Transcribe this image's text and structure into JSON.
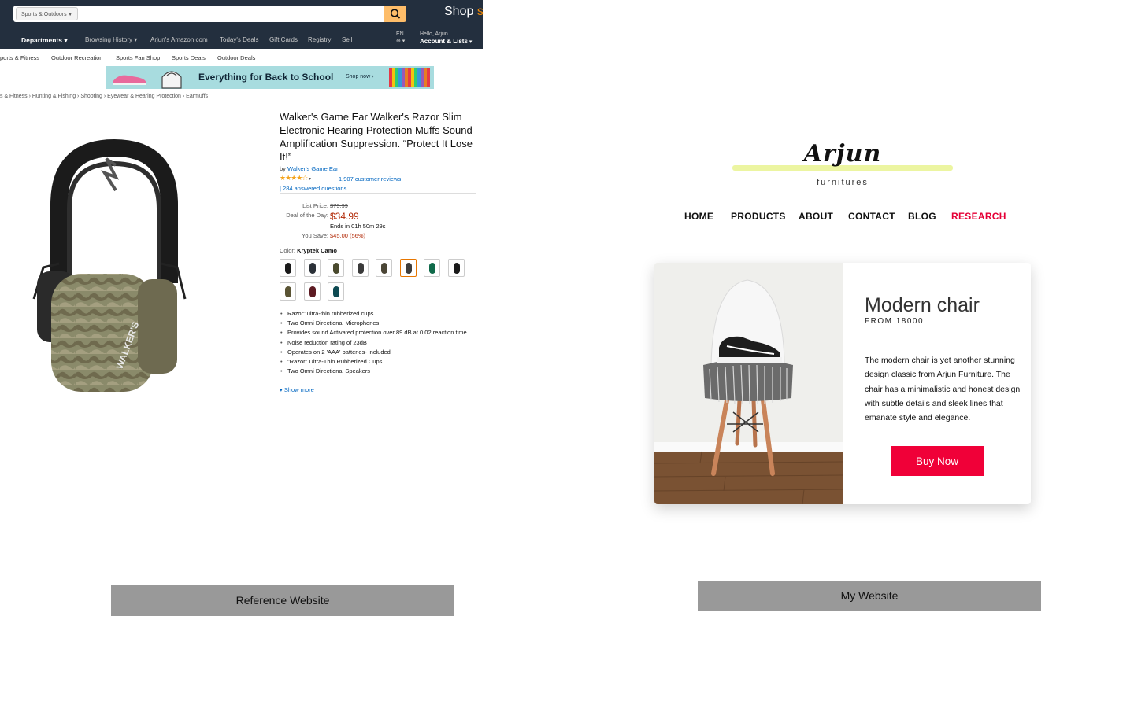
{
  "reference": {
    "search_category": "Sports & Outdoors",
    "shop_text_a": "Shop ",
    "shop_text_b": "s",
    "nav": [
      "Departments",
      "Browsing History",
      "Arjun's Amazon.com",
      "Today's Deals",
      "Gift Cards",
      "Registry",
      "Sell"
    ],
    "lang": "EN",
    "account_hello": "Hello, Arjun",
    "account_label": "Account & Lists",
    "subnav": [
      "ports & Fitness",
      "Outdoor Recreation",
      "Sports Fan Shop",
      "Sports Deals",
      "Outdoor Deals"
    ],
    "banner_text": "Everything for Back to School",
    "banner_cta": "Shop now ›",
    "breadcrumb": "s & Fitness  ›  Hunting & Fishing  ›  Shooting  ›  Eyewear & Hearing Protection  ›  Earmuffs",
    "product_title": "Walker's Game Ear Walker's Razor Slim Electronic Hearing Protection Muffs Sound Amplification Suppression. “Protect It Lose It!”",
    "by_label": "by ",
    "brand_link": "Walker's Game Ear",
    "stars": "★★★★☆",
    "reviews": "1,907 customer reviews",
    "questions": "|  284 answered questions",
    "list_price_label": "List Price:",
    "list_price": "$79.99",
    "deal_label": "Deal of the Day:",
    "deal_price": "$34.99",
    "ends_in": "Ends in 01h 50m 29s",
    "you_save_label": "You Save:",
    "you_save": "$45.00 (56%)",
    "color_label": "Color: ",
    "color_value": "Kryptek Camo",
    "swatch_colors": [
      "#1a1a1a",
      "#2b3138",
      "#4a4a2e",
      "#3a3a3a",
      "#4b4636",
      "#3d3d3d",
      "#0f6a4a",
      "#1a1a1a",
      "#5a5434",
      "#5c1a22",
      "#0e4a52"
    ],
    "selected_swatch": 5,
    "bullets": [
      "Razor\" ultra-thin rubberized cups",
      "Two Omni Directional Microphones",
      "Provides sound Activated protection over 89 dB at 0.02 reaction time",
      "Noise reduction rating of 23dB",
      "Operates on 2 'AAA' batteries- included",
      "\"Razor\" Ultra-Thin Rubberized Cups",
      "Two Omni Directional Speakers"
    ],
    "show_more": "Show more",
    "caption": "Reference Website"
  },
  "mine": {
    "brand": "Arjun",
    "brand_sub": "furnitures",
    "nav": [
      "HOME",
      "PRODUCTS",
      "ABOUT",
      "CONTACT",
      "BLOG",
      "RESEARCH"
    ],
    "active_nav": "RESEARCH",
    "accent": "#f00038",
    "product_title": "Modern chair",
    "price_line": "FROM 18000",
    "description": "The modern chair is yet another stunning design classic from Arjun Furniture. The chair has a minimalistic and honest design with subtle details and sleek lines that emanate style and elegance.",
    "buy_label": "Buy Now",
    "caption": "My Website"
  }
}
